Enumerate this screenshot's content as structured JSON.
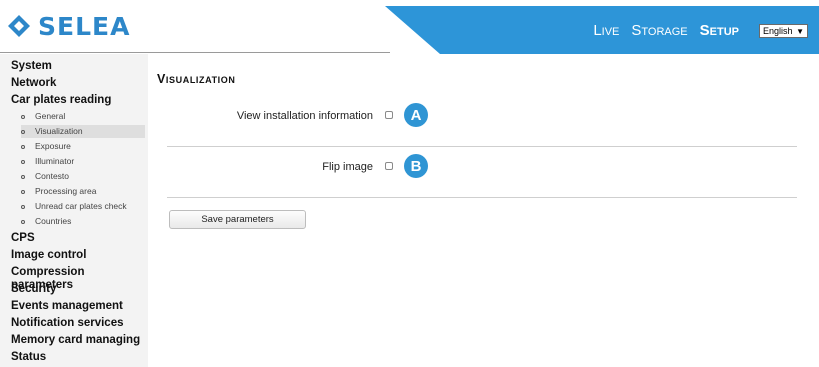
{
  "brand": {
    "logo_text": "SELEA",
    "accent": "#2d87c9",
    "band_color": "#2d95d8"
  },
  "topnav": {
    "items": [
      "Live",
      "Storage",
      "Setup"
    ],
    "active": "Setup"
  },
  "language": {
    "selected": "English"
  },
  "sidebar": {
    "top_items": [
      "System",
      "Network",
      "Car plates reading"
    ],
    "sub_items": [
      "General",
      "Visualization",
      "Exposure",
      "Illuminator",
      "Contesto",
      "Processing area",
      "Unread car plates check",
      "Countries"
    ],
    "selected_sub": "Visualization",
    "bottom_items": [
      "CPS",
      "Image control",
      "Compression parameters",
      "Security",
      "Events management",
      "Notification services",
      "Memory card managing",
      "Status"
    ]
  },
  "main": {
    "title": "Visualization",
    "rows": [
      {
        "label": "View installation information",
        "checked": false,
        "marker": "A"
      },
      {
        "label": "Flip image",
        "checked": false,
        "marker": "B"
      }
    ],
    "save_label": "Save parameters"
  }
}
